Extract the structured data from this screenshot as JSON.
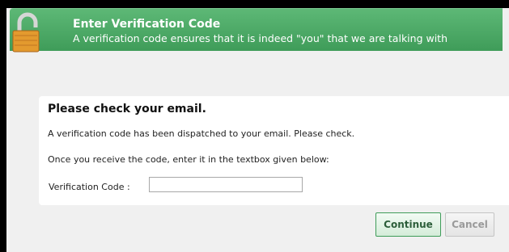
{
  "header": {
    "title": "Enter Verification Code",
    "subtitle": "A verification code ensures that it is indeed \"you\" that we are talking with"
  },
  "message": {
    "title": "Please check your email.",
    "line1": "A verification code has been dispatched to your email. Please check.",
    "line2": "Once you receive the code, enter it in the textbox given below:"
  },
  "form": {
    "code_label": "Verification Code :",
    "code_value": ""
  },
  "buttons": {
    "continue_label": "Continue",
    "cancel_label": "Cancel"
  },
  "icons": {
    "header": "padlock-icon"
  },
  "colors": {
    "header_green": "#3f9c59",
    "lock_gold": "#e39a2e",
    "background": "#f0f0f0",
    "card": "#ffffff"
  }
}
